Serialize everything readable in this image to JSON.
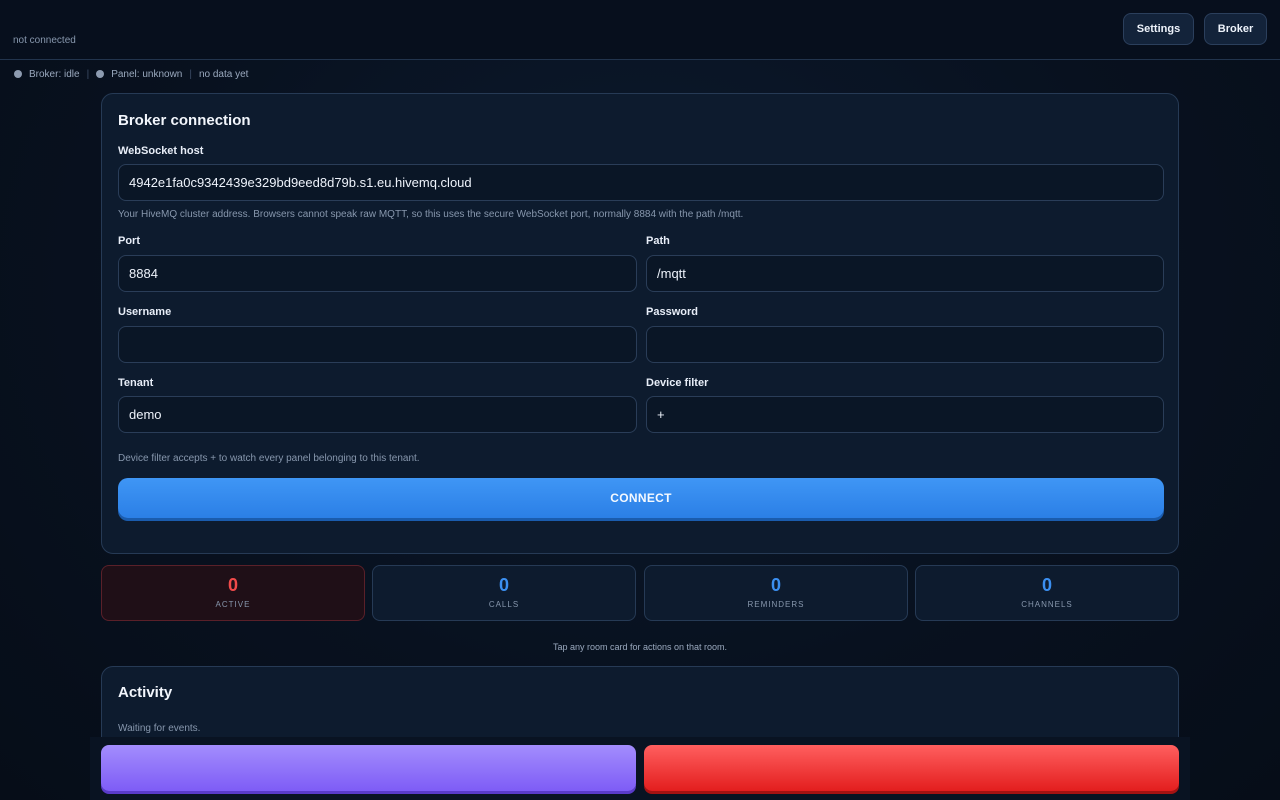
{
  "header": {
    "connection_state": "not connected",
    "settings_label": "Settings",
    "broker_label": "Broker"
  },
  "status": {
    "broker": "Broker: idle",
    "panel": "Panel: unknown",
    "data": "no data yet",
    "separator": "|"
  },
  "broker_form": {
    "title": "Broker connection",
    "host_label": "WebSocket host",
    "host_value": "4942e1fa0c9342439e329bd9eed8d79b.s1.eu.hivemq.cloud",
    "host_hint": "Your HiveMQ cluster address. Browsers cannot speak raw MQTT, so this uses the secure WebSocket port, normally 8884 with the path /mqtt.",
    "port_label": "Port",
    "port_value": "8884",
    "path_label": "Path",
    "path_value": "/mqtt",
    "username_label": "Username",
    "username_value": "",
    "password_label": "Password",
    "password_value": "",
    "tenant_label": "Tenant",
    "tenant_value": "demo",
    "device_filter_label": "Device filter",
    "device_filter_value": "+",
    "filter_hint": "Device filter accepts + to watch every panel belonging to this tenant.",
    "connect_label": "CONNECT",
    "connect_color": "#2f86ee"
  },
  "stats": [
    {
      "value": "0",
      "label": "ACTIVE",
      "color": "#f04a4a"
    },
    {
      "value": "0",
      "label": "CALLS",
      "color": "#3b8ff0"
    },
    {
      "value": "0",
      "label": "REMINDERS",
      "color": "#3b8ff0"
    },
    {
      "value": "0",
      "label": "CHANNELS",
      "color": "#3b8ff0"
    }
  ],
  "tap_hint": "Tap any room card for actions on that room.",
  "activity": {
    "title": "Activity",
    "empty_text": "Waiting for events."
  },
  "bottom_actions": {
    "primary_color": "#8b6cf8",
    "danger_color": "#ef2f2f"
  }
}
